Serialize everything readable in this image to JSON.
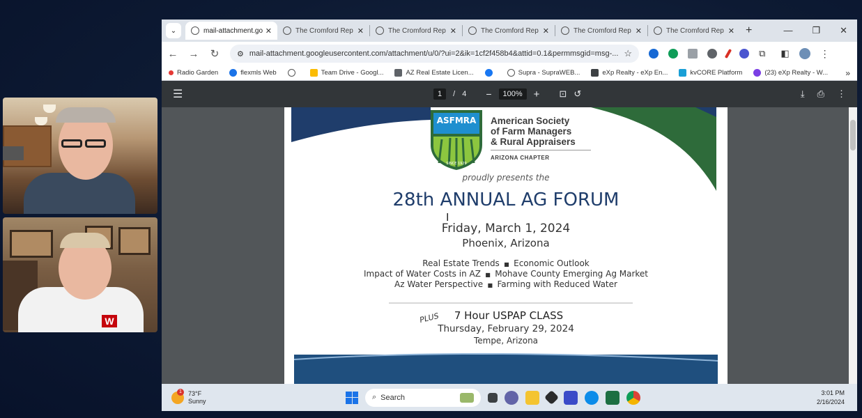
{
  "browser": {
    "tabs": [
      {
        "title": "mail-attachment.go",
        "active": true
      },
      {
        "title": "The Cromford Rep",
        "active": false
      },
      {
        "title": "The Cromford Rep",
        "active": false
      },
      {
        "title": "The Cromford Rep",
        "active": false
      },
      {
        "title": "The Cromford Rep",
        "active": false
      },
      {
        "title": "The Cromford Rep",
        "active": false
      }
    ],
    "url": "mail-attachment.googleusercontent.com/attachment/u/0/?ui=2&ik=1cf2f458b4&attid=0.1&permmsgid=msg-...",
    "bookmarks": [
      "Radio Garden",
      "flexmls Web",
      "",
      "Team Drive - Googl...",
      "AZ Real Estate Licen...",
      "",
      "Supra - SupraWEB...",
      "eXp Realty - eXp En...",
      "kvCORE Platform",
      "(23) eXp Realty - W..."
    ]
  },
  "pdf_viewer": {
    "page_current": "1",
    "page_total": "4",
    "page_separator": "/",
    "zoom": "100%"
  },
  "document": {
    "logo_badge": "ASFMRA",
    "logo_since": "SINCE 1929",
    "org_line1": "American Society",
    "org_line2": "of Farm Managers",
    "org_line3": "& Rural Appraisers",
    "chapter": "ARIZONA CHAPTER",
    "presents": "proudly presents the",
    "event_title": "28th ANNUAL AG FORUM",
    "event_date": "Friday, March 1, 2024",
    "event_location": "Phoenix, Arizona",
    "topics_line1_a": "Real Estate Trends",
    "topics_line1_b": "Economic Outlook",
    "topics_line2_a": "Impact of Water Costs in AZ",
    "topics_line2_b": "Mohave County Emerging Ag Market",
    "topics_line3_a": "Az Water Perspective",
    "topics_line3_b": "Farming with Reduced Water",
    "plus": "PLUS",
    "class_title": "7 Hour USPAP CLASS",
    "class_date": "Thursday, February 29, 2024",
    "class_location": "Tempe, Arizona"
  },
  "taskbar": {
    "weather_badge": "1",
    "weather_temp": "73°F",
    "weather_desc": "Sunny",
    "search_label": "Search",
    "time": "3:01 PM",
    "date": "2/16/2024"
  },
  "colors": {
    "navy": "#1f3d6b",
    "green": "#2e6b3a",
    "lime": "#8cc63f",
    "pdf_toolbar": "#323639"
  }
}
